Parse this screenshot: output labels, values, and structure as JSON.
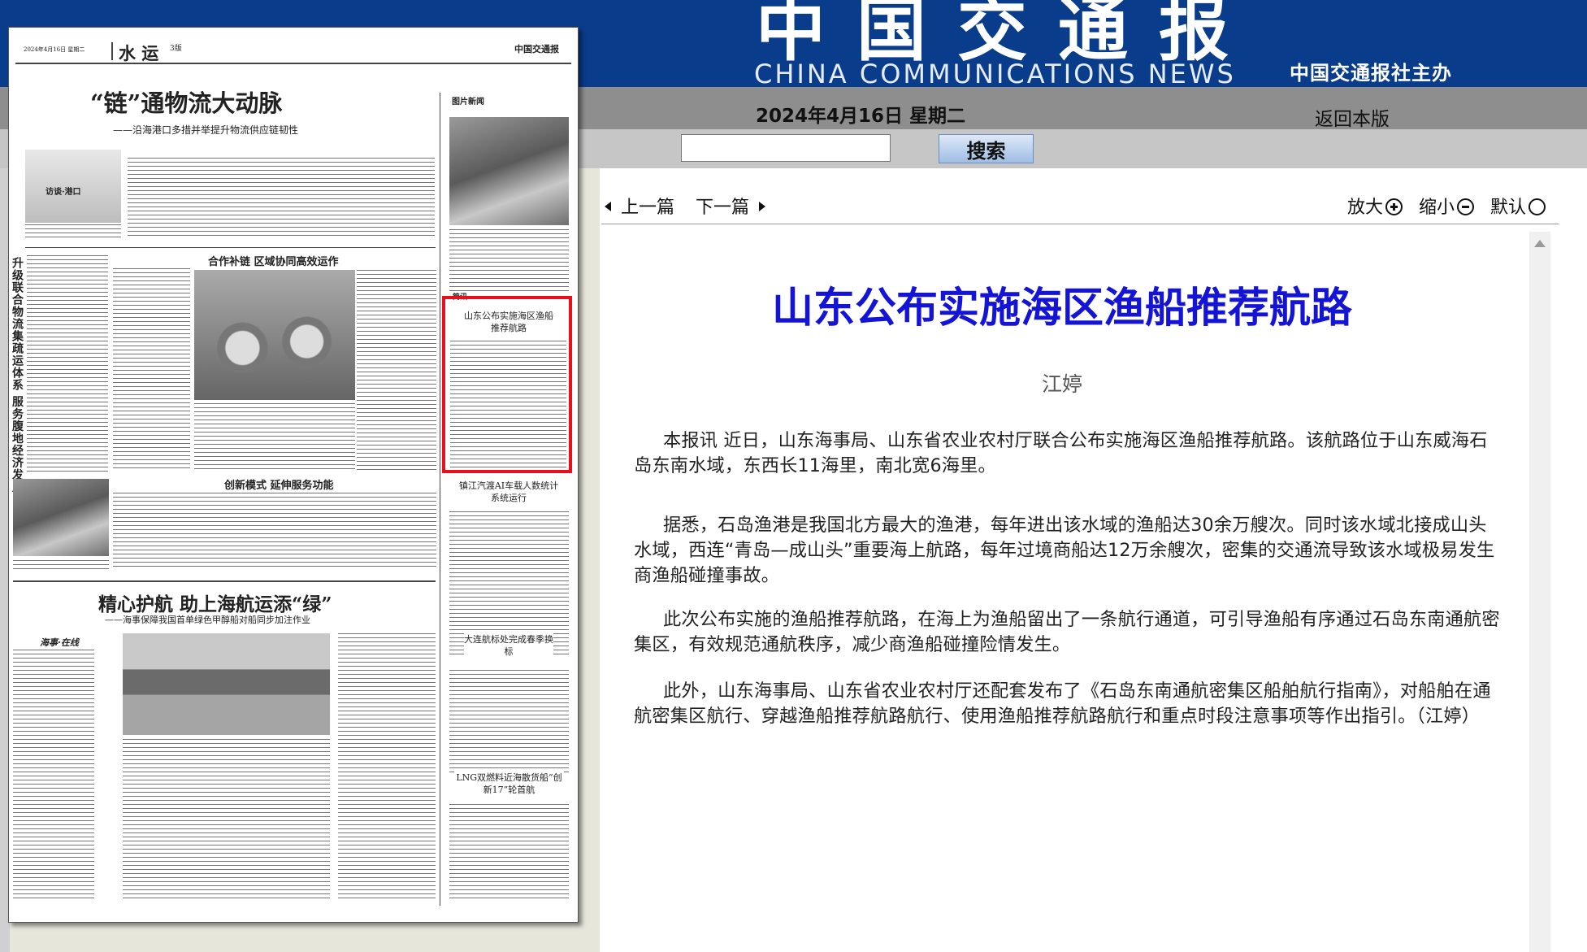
{
  "header": {
    "masthead": "中国交通报",
    "masthead_en": "CHINA COMMUNICATIONS NEWS",
    "sponsor": "中国交通报社主办",
    "date": "2024年4月16日 星期二",
    "back_link": "返回本版"
  },
  "search": {
    "value": "",
    "button_label": "搜索"
  },
  "newspaper": {
    "page_date": "2024年4月16日 星期二",
    "section": "水 运",
    "page_no": "3版",
    "masthead_small": "中国交通报",
    "headline_1": "“链”通物流大动脉",
    "subhead_1": "——沿海港口多措并举提升物流供应链韧性",
    "section_label_1": "合作补链 区域协同高效运作",
    "section_label_2": "创新模式 延伸服务功能",
    "vertical_heading": "升级联合物流集疏运体系 服务腹地经济发展",
    "headline_2": "精心护航 助上海航运添“绿”",
    "subhead_2": "——海事保障我国首单绿色甲醇船对船同步加注作业",
    "photo_news": "图片新闻",
    "brief_label": "简讯",
    "highlight_title": "山东公布实施海区渔船推荐航路",
    "side_title_1": "镇江汽渡AI车载人数统计系统运行",
    "side_title_2": "大连航标处完成春季换标",
    "side_title_3": "LNG双燃料近海散货船“创新17”轮首航",
    "logo_caption": "访谈·港口",
    "column_tag": "海事·在线"
  },
  "nav": {
    "prev": "上一篇",
    "next": "下一篇",
    "zoom_in": "放大",
    "zoom_out": "缩小",
    "zoom_default": "默认"
  },
  "article": {
    "title": "山东公布实施海区渔船推荐航路",
    "author": "江婷",
    "paragraphs": [
      "本报讯 近日，山东海事局、山东省农业农村厅联合公布实施海区渔船推荐航路。该航路位于山东威海石岛东南水域，东西长11海里，南北宽6海里。",
      "据悉，石岛渔港是我国北方最大的渔港，每年进出该水域的渔船达30余万艘次。同时该水域北接成山头水域，西连“青岛—成山头”重要海上航路，每年过境商船达12万余艘次，密集的交通流导致该水域极易发生商渔船碰撞事故。",
      "此次公布实施的渔船推荐航路，在海上为渔船留出了一条航行通道，可引导渔船有序通过石岛东南通航密集区，有效规范通航秩序，减少商渔船碰撞险情发生。",
      "此外，山东海事局、山东省农业农村厅还配套发布了《石岛东南通航密集区船舶航行指南》，对船舶在通航密集区航行、穿越渔船推荐航路航行、使用渔船推荐航路航行和重点时段注意事项等作出指引。（江婷）"
    ]
  },
  "icons": {
    "prev": "caret-left",
    "next": "caret-right",
    "zoom_in": "circle-plus",
    "zoom_out": "circle-minus",
    "zoom_default": "circle",
    "scroll_up": "triangle-up"
  },
  "colors": {
    "header_blue": "#0a3c8c",
    "title_blue": "#1414d6",
    "highlight_red": "#e8101a"
  }
}
